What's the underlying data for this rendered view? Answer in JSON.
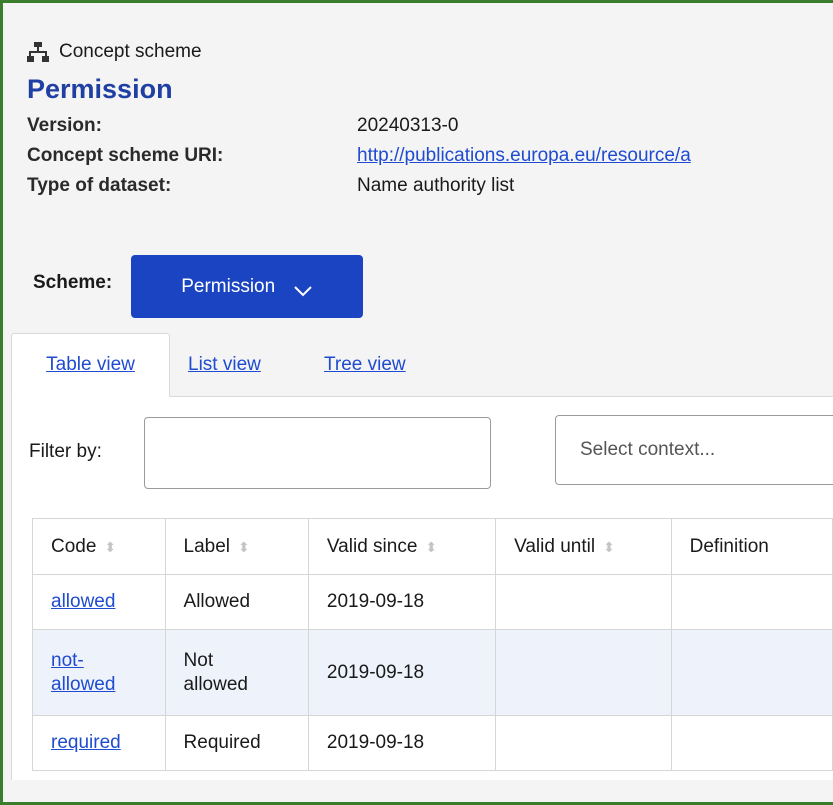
{
  "header": {
    "kind_icon": "hierarchy-icon",
    "kind_label": "Concept scheme",
    "title": "Permission",
    "meta": [
      {
        "label": "Version:",
        "value": "20240313-0",
        "is_link": false
      },
      {
        "label": "Concept scheme URI:",
        "value": "http://publications.europa.eu/resource/a",
        "is_link": true
      },
      {
        "label": "Type of dataset:",
        "value": "Name authority list",
        "is_link": false
      }
    ]
  },
  "scheme": {
    "label": "Scheme:",
    "selected": "Permission",
    "icon": "chevron-down-icon"
  },
  "tabs": [
    {
      "label": "Table view",
      "active": true
    },
    {
      "label": "List view",
      "active": false
    },
    {
      "label": "Tree view",
      "active": false
    }
  ],
  "filter": {
    "label": "Filter by:",
    "value": "",
    "context_placeholder": "Select context..."
  },
  "table": {
    "columns": [
      "Code",
      "Label",
      "Valid since",
      "Valid until",
      "Definition"
    ],
    "rows": [
      {
        "code": "allowed",
        "label": "Allowed",
        "valid_since": "2019-09-18",
        "valid_until": "",
        "definition": ""
      },
      {
        "code": "not-allowed",
        "label": "Not allowed",
        "valid_since": "2019-09-18",
        "valid_until": "",
        "definition": ""
      },
      {
        "code": "required",
        "label": "Required",
        "valid_since": "2019-09-18",
        "valid_until": "",
        "definition": ""
      }
    ]
  },
  "colors": {
    "accent": "#1a44c2",
    "title": "#1f3fa3",
    "link": "#1f4bd0",
    "frame": "#3a7d2c",
    "row_alt": "#eef3fb"
  }
}
